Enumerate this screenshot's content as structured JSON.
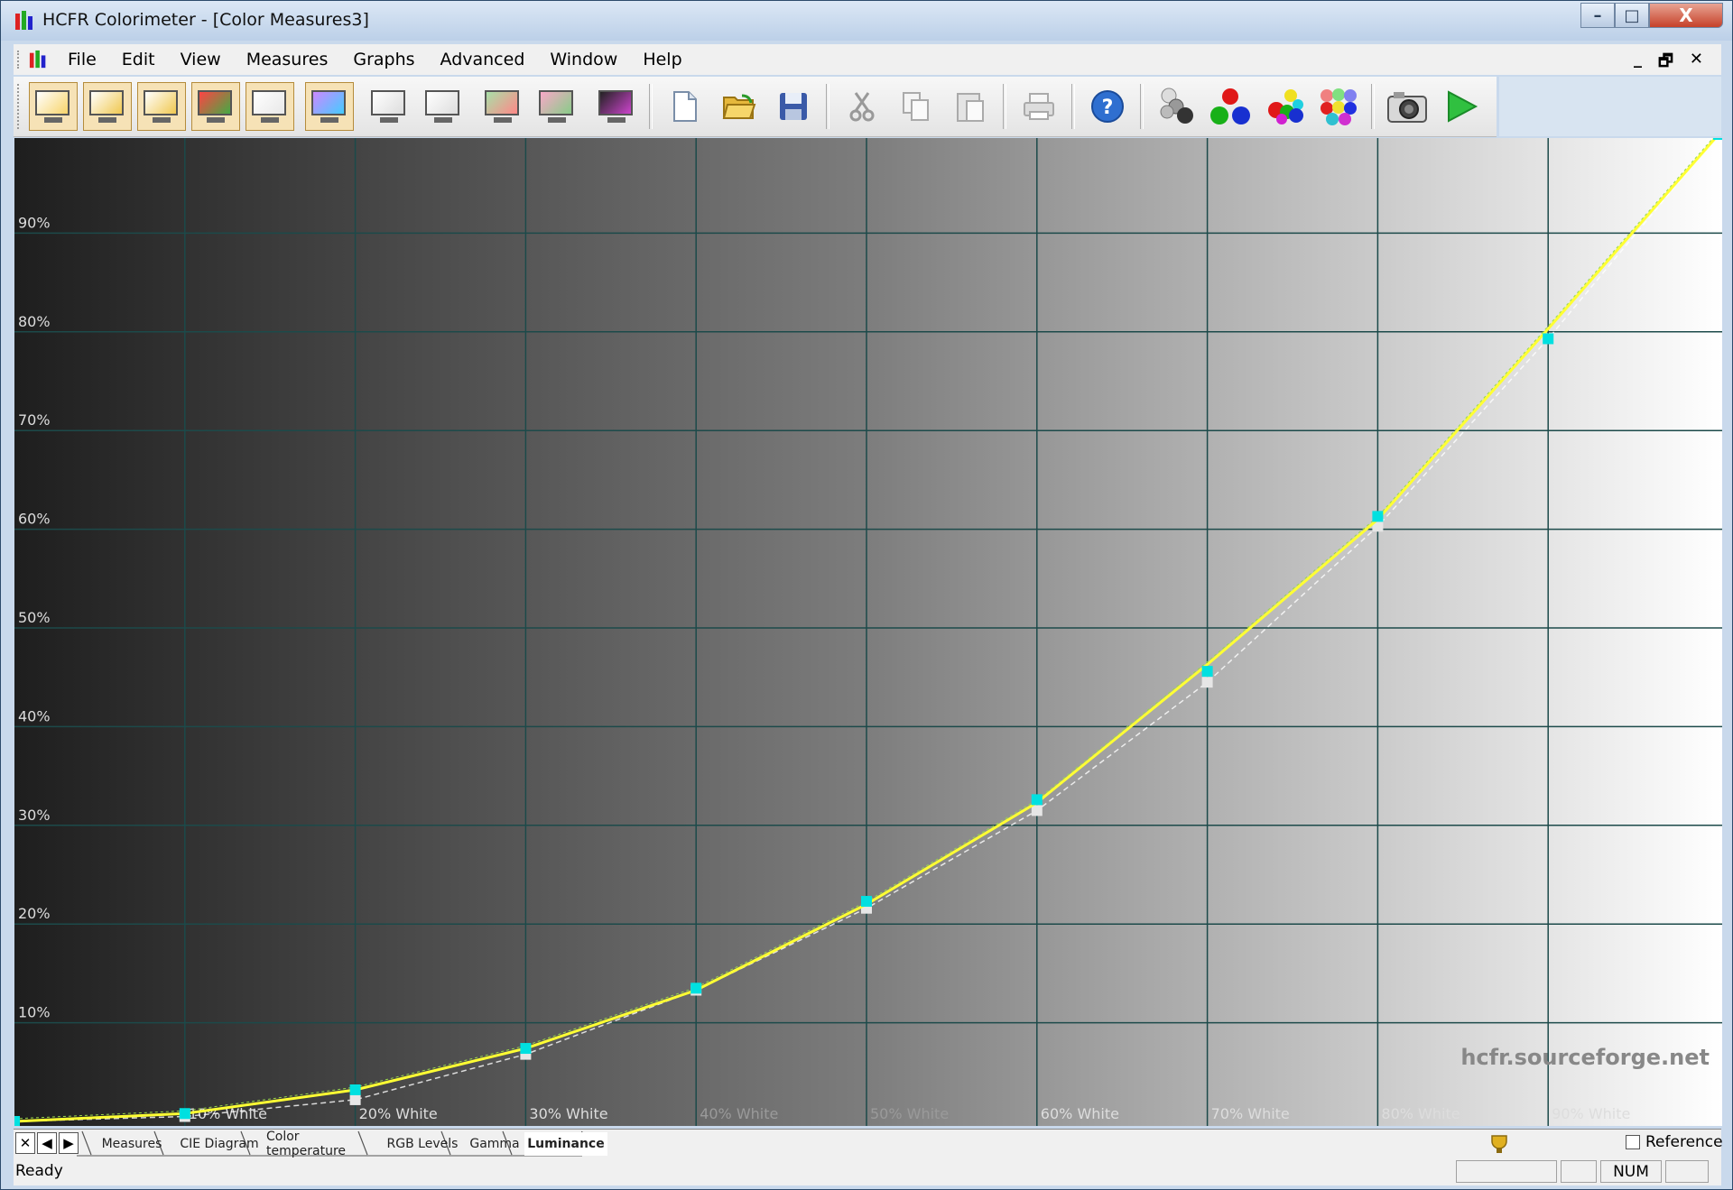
{
  "window": {
    "title": "HCFR Colorimeter - [Color Measures3]",
    "controls": {
      "minimize": "–",
      "maximize": "□",
      "close": "X"
    }
  },
  "menu": {
    "items": [
      "File",
      "Edit",
      "View",
      "Measures",
      "Graphs",
      "Advanced",
      "Window",
      "Help"
    ],
    "mdi_controls": {
      "minimize": "_",
      "restore": "🗗",
      "close": "✕"
    }
  },
  "toolbar": {
    "view_buttons": [
      "measures-view-icon",
      "gamma-view-icon",
      "luminance-view-icon",
      "rgb-levels-view-icon",
      "color-temp-view-icon",
      "cie-diagram-view-icon",
      "near-black-view-icon",
      "near-white-view-icon",
      "saturation-luminance-view-icon",
      "saturation-shift-view-icon",
      "colorchecker-view-icon"
    ],
    "file_buttons": [
      "new-file-icon",
      "open-folder-icon",
      "save-icon"
    ],
    "edit_buttons": [
      "cut-icon",
      "copy-icon",
      "paste-icon"
    ],
    "misc_buttons": [
      "print-icon",
      "help-icon"
    ],
    "measure_buttons": [
      "measure-grayscale-icon",
      "measure-primaries-icon",
      "measure-secondaries-icon",
      "measure-saturations-icon",
      "measure-single-icon",
      "continuous-measure-play-icon"
    ]
  },
  "tabs": {
    "nav": [
      "✕",
      "◀",
      "▶"
    ],
    "items": [
      "Measures",
      "CIE Diagram",
      "Color temperature",
      "RGB Levels",
      "Gamma",
      "Luminance"
    ],
    "active": "Luminance",
    "reference_label": "Reference"
  },
  "status": {
    "text": "Ready",
    "num": "NUM"
  },
  "chart_data": {
    "type": "line",
    "watermark": "hcfr.sourceforge.net",
    "x": [
      0,
      10,
      20,
      30,
      40,
      50,
      60,
      70,
      80,
      90,
      100
    ],
    "x_tick_labels": [
      "",
      "10% White",
      "20% White",
      "30% White",
      "40% White",
      "50% White",
      "60% White",
      "70% White",
      "80% White",
      "90% White",
      ""
    ],
    "y_tick_labels": [
      "10%",
      "20%",
      "30%",
      "40%",
      "50%",
      "60%",
      "70%",
      "80%",
      "90%"
    ],
    "ylim": [
      0,
      100
    ],
    "xlim": [
      0,
      100
    ],
    "grid": true,
    "series": [
      {
        "color": "#ffff33",
        "style": "solid",
        "values": [
          0,
          0.8,
          3.2,
          7.4,
          13.3,
          22.0,
          32.3,
          46.3,
          61.0,
          80.3,
          100
        ]
      },
      {
        "color": "#00e0e0",
        "style": "marker",
        "values": [
          0,
          0.8,
          3.2,
          7.4,
          13.5,
          22.3,
          32.6,
          45.6,
          61.3,
          79.3,
          100
        ]
      },
      {
        "color": "#ffffff",
        "style": "dashed",
        "values": [
          0,
          0.5,
          2.2,
          6.8,
          13.3,
          21.6,
          31.5,
          44.5,
          60.3,
          79.3,
          100
        ]
      }
    ],
    "colors": {
      "grid": "#1c4a4a",
      "label": "#dddddd",
      "label_dim": "#9a9a9a"
    }
  }
}
